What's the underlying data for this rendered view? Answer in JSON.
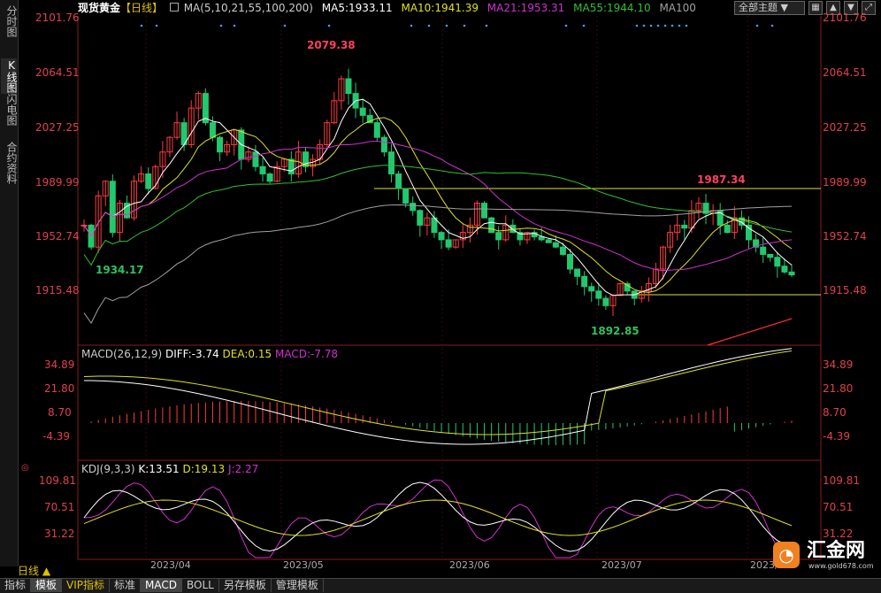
{
  "sidebar": {
    "tabs": [
      {
        "label": "分时图",
        "active": false
      },
      {
        "label": "K线图",
        "active": true
      },
      {
        "label": "闪电图",
        "active": false
      },
      {
        "label": "合约资料",
        "active": false
      }
    ]
  },
  "header": {
    "instrument": "现货黄金",
    "period_tag": "【日线】",
    "ma_label": "MA(5,10,21,55,100,200)",
    "ma5": "MA5:1933.11",
    "ma10": "MA10:1941.39",
    "ma21": "MA21:1953.31",
    "ma55": "MA55:1944.10",
    "ma100": "MA100",
    "theme_dropdown": "全部主题"
  },
  "colors": {
    "up": "#ff3b3b",
    "down": "#22c86e",
    "ma5": "#ffffff",
    "ma10": "#e0e020",
    "ma21": "#d030d0",
    "ma55": "#30c030",
    "ma100": "#a0a0a0",
    "ma200": "#ff3030",
    "axis_red": "#e04050"
  },
  "main_axis": {
    "ticks": [
      "2101.76",
      "2064.51",
      "2027.25",
      "1989.99",
      "1952.74",
      "1915.48"
    ]
  },
  "annotations": {
    "high": "2079.38",
    "low1": "1934.17",
    "high2": "1987.34",
    "low2": "1892.85"
  },
  "macd": {
    "title": "MACD(26,12,9)",
    "diff": "DIFF:-3.74",
    "dea": "DEA:0.15",
    "macd": "MACD:-7.78",
    "ticks": [
      "34.89",
      "21.80",
      "8.70",
      "-4.39"
    ]
  },
  "kdj": {
    "title": "KDJ(9,3,3)",
    "k": "K:13.51",
    "d": "D:19.13",
    "j": "J:2.27",
    "ticks": [
      "109.81",
      "70.51",
      "31.22"
    ]
  },
  "xaxis": {
    "labels": [
      "2023/04",
      "2023/05",
      "2023/06",
      "2023/07",
      "2023/"
    ]
  },
  "bottom": {
    "period": "日线",
    "tabs": [
      "指标",
      "模板",
      "VIP指标",
      "标准",
      "MACD",
      "BOLL",
      "另存模板",
      "管理模板"
    ],
    "active": [
      "模板",
      "MACD"
    ]
  },
  "logo": {
    "name": "汇金网",
    "url": "www.gold678.com"
  }
}
